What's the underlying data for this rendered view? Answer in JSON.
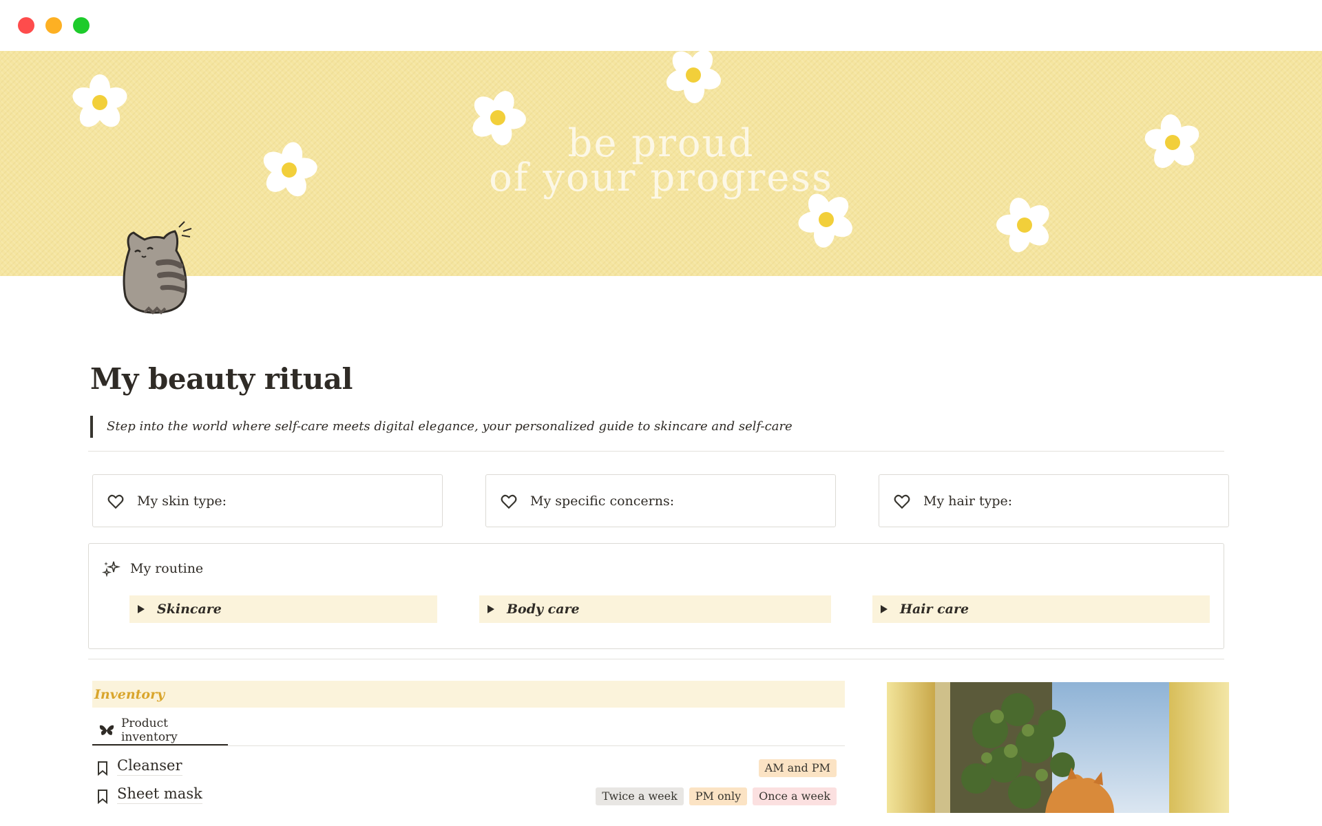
{
  "window": {
    "controls": [
      "close",
      "minimize",
      "zoom"
    ]
  },
  "cover": {
    "line1": "be proud",
    "line2": "of your progress",
    "background_color": "#f5e5a0"
  },
  "page": {
    "title": "My beauty ritual",
    "quote": "Step into the world where self-care meets digital elegance, your personalized guide to skincare and self-care"
  },
  "cards": [
    {
      "label": "My skin type:",
      "icon": "heart-icon"
    },
    {
      "label": "My specific concerns:",
      "icon": "heart-icon"
    },
    {
      "label": "My hair type:",
      "icon": "heart-icon"
    }
  ],
  "routine": {
    "label": "My routine",
    "icon": "sparkle-icon",
    "toggles": [
      "Skincare",
      "Body care",
      "Hair care"
    ]
  },
  "inventory": {
    "heading": "Inventory",
    "tab": "Product inventory",
    "tab_icon": "butterfly-icon",
    "rows": [
      {
        "name": "Cleanser",
        "tags": [
          {
            "text": "AM and PM",
            "color": "#fbe3c4"
          }
        ]
      },
      {
        "name": "Sheet mask",
        "tags": [
          {
            "text": "Twice a week",
            "color": "#e8e6e3"
          },
          {
            "text": "PM only",
            "color": "#fbe3c4"
          },
          {
            "text": "Once a week",
            "color": "#fbe0e0"
          }
        ]
      }
    ]
  },
  "colors": {
    "accent_gold": "#d9a52c",
    "toggle_bg": "#fbf3db",
    "text": "#2f2b26"
  }
}
